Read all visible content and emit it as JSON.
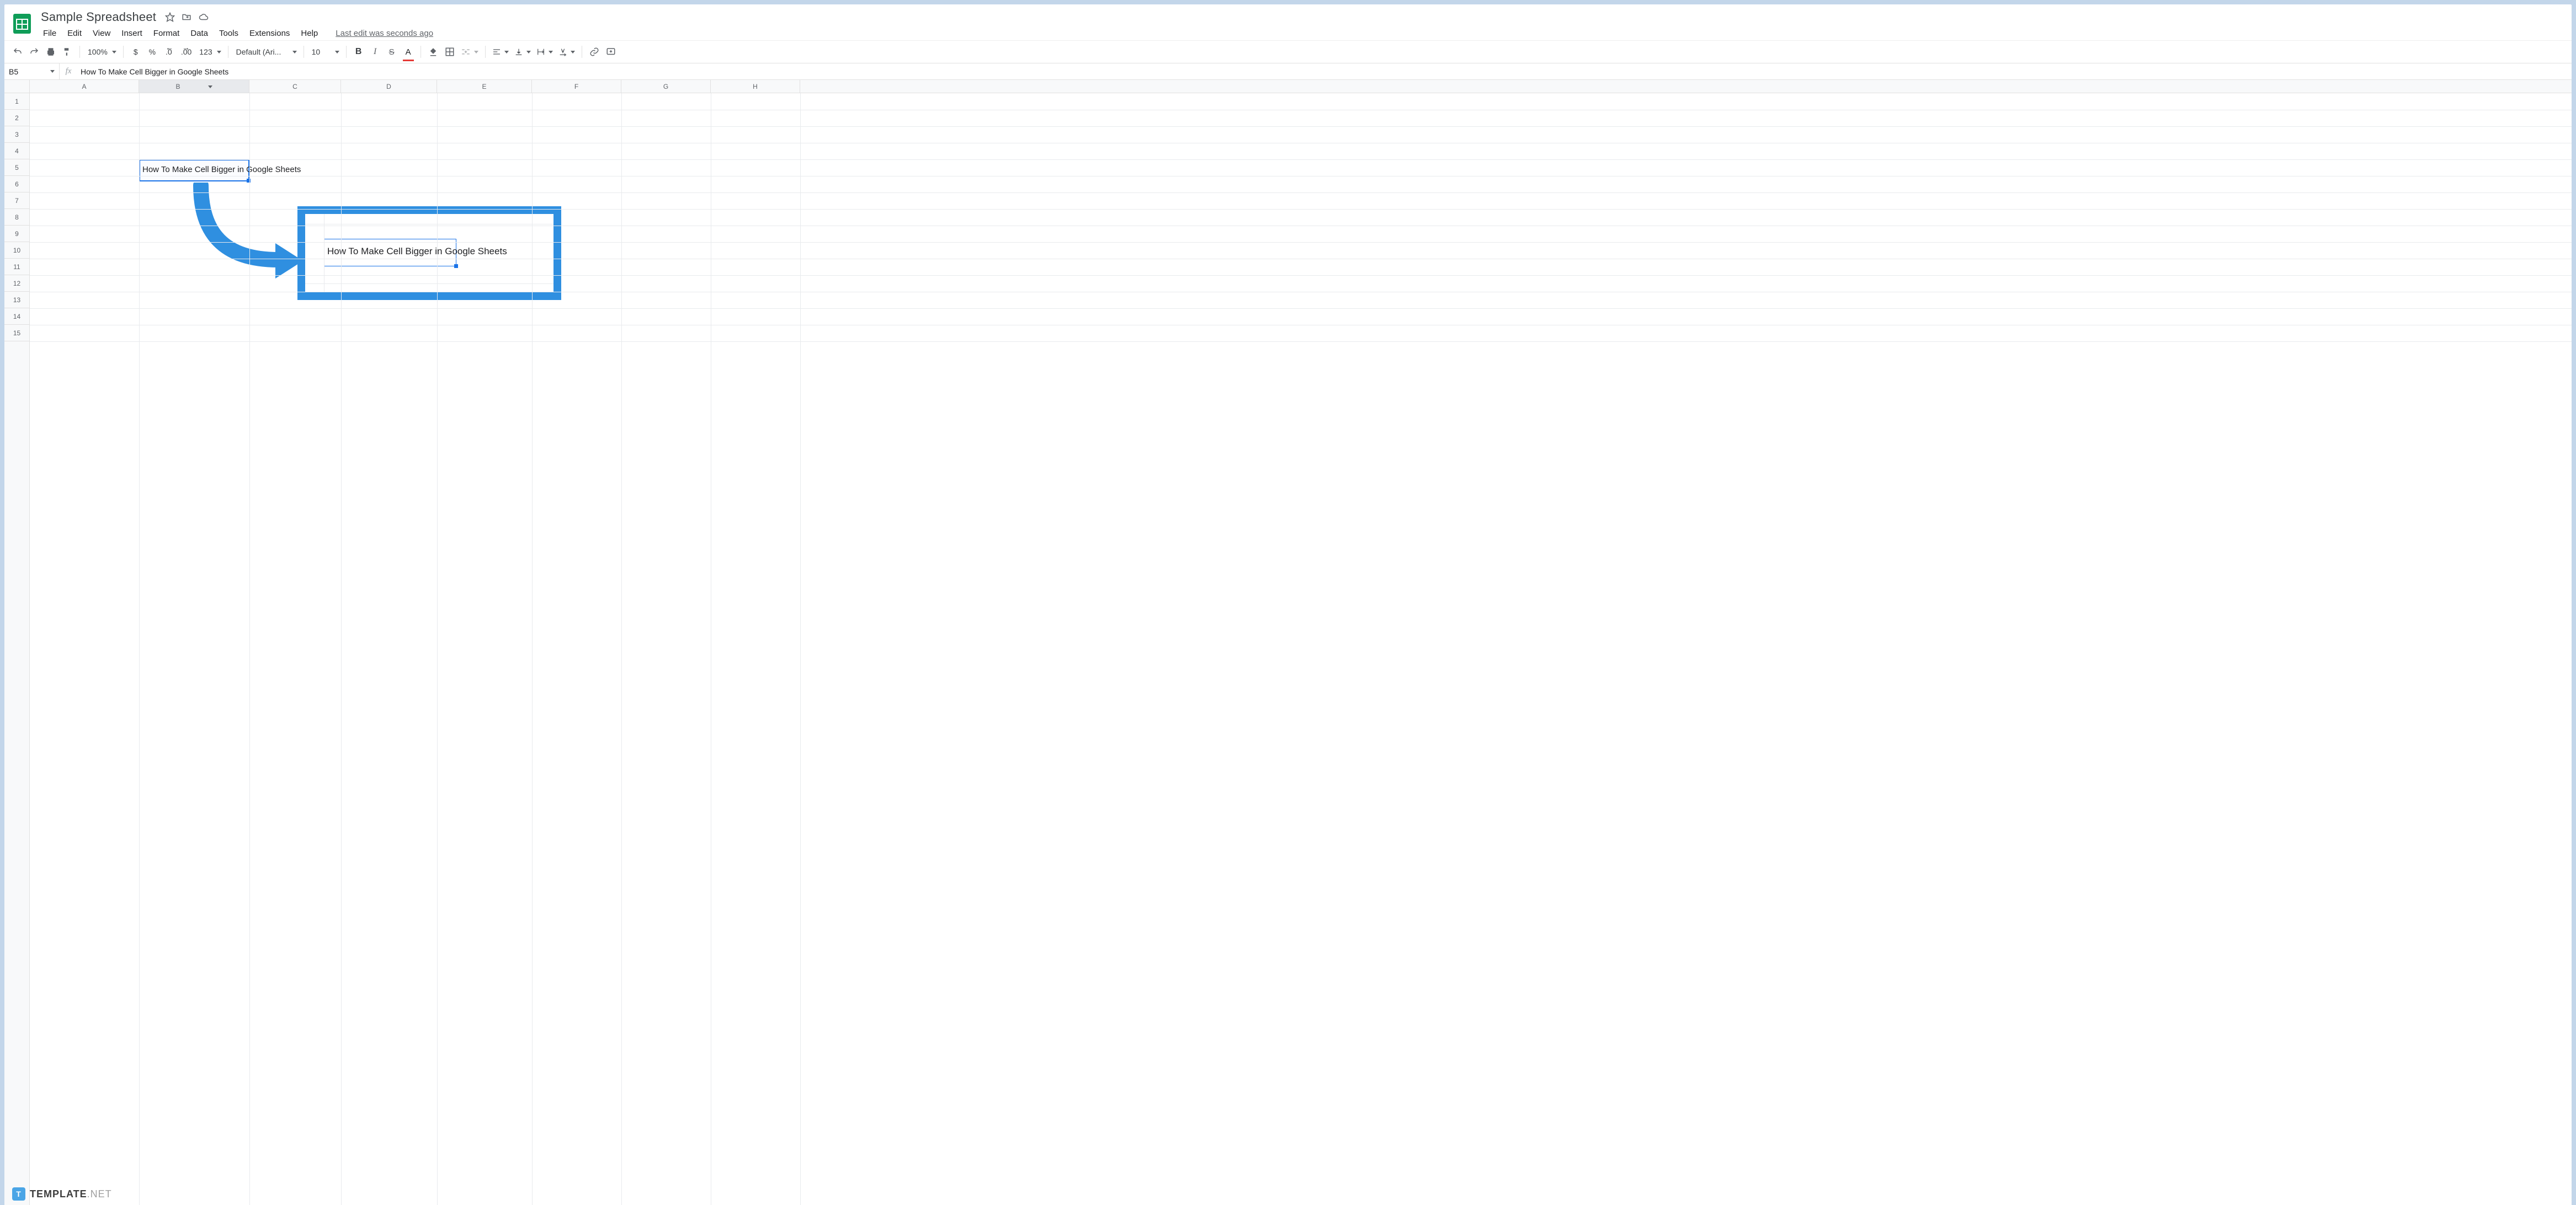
{
  "doc_title": "Sample Spreadsheet",
  "menus": [
    "File",
    "Edit",
    "View",
    "Insert",
    "Format",
    "Data",
    "Tools",
    "Extensions",
    "Help"
  ],
  "last_edit": "Last edit was seconds ago",
  "toolbar": {
    "zoom": "100%",
    "font": "Default (Ari...",
    "font_size": "10",
    "currency": "$",
    "percent": "%",
    "dec_dec": ".0",
    "dec_inc": ".00",
    "fmt": "123"
  },
  "name_box": "B5",
  "formula_bar": "How To Make Cell Bigger in Google Sheets",
  "columns": [
    "A",
    "B",
    "C",
    "D",
    "E",
    "F",
    "G",
    "H"
  ],
  "rows": [
    "1",
    "2",
    "3",
    "4",
    "5",
    "6",
    "7",
    "8",
    "9",
    "10",
    "11",
    "12",
    "13",
    "14",
    "15"
  ],
  "selected_column": "B",
  "cell_value": "How To Make Cell Bigger in Google Sheets",
  "callout_value": "How To Make Cell Bigger in Google Sheets",
  "footer_brand": "TEMPLATE",
  "footer_suffix": ".NET"
}
